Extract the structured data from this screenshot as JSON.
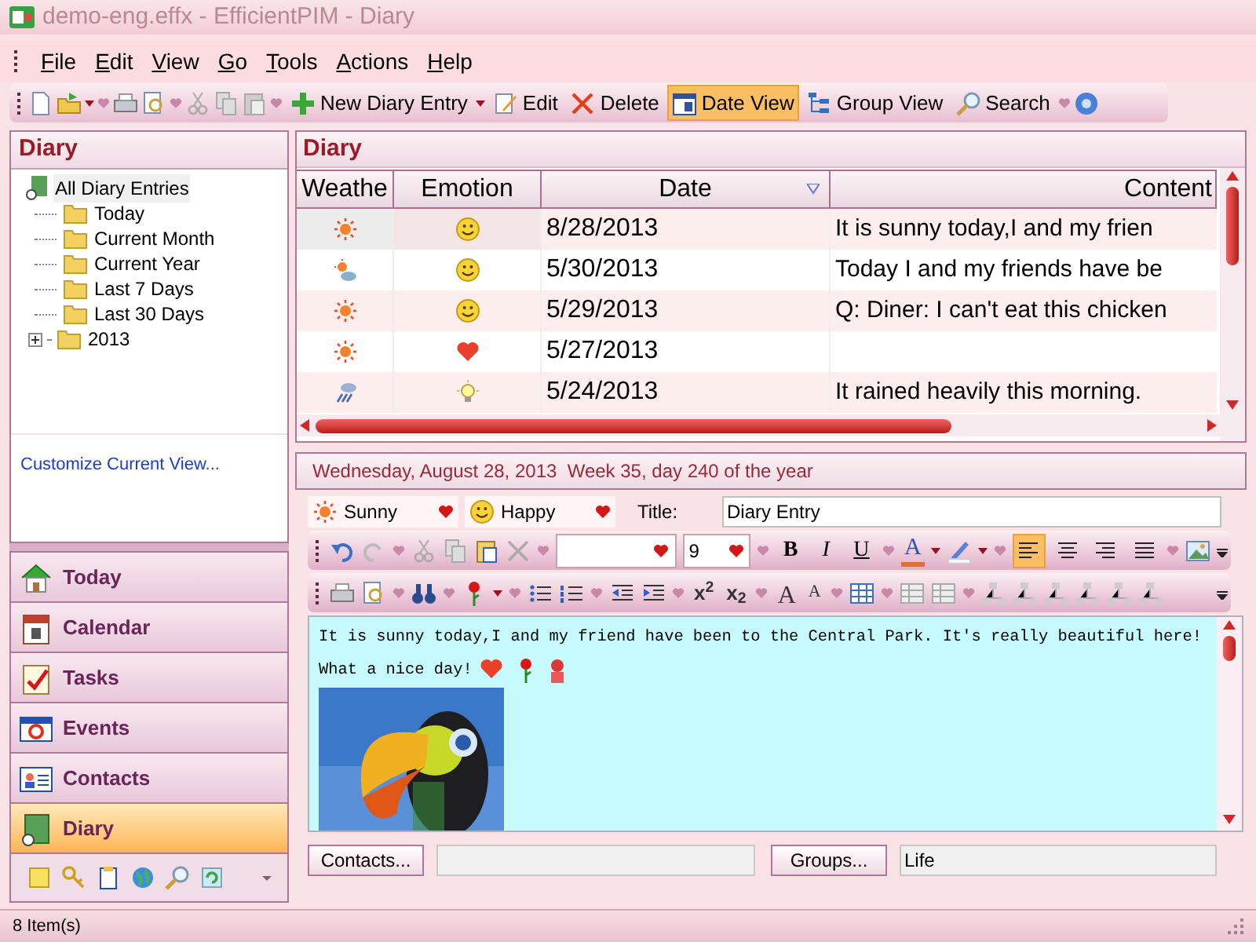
{
  "window": {
    "title": "demo-eng.effx - EfficientPIM - Diary"
  },
  "menu": [
    "File",
    "Edit",
    "View",
    "Go",
    "Tools",
    "Actions",
    "Help"
  ],
  "toolbar": [
    {
      "label": "New Diary Entry",
      "kind": "new",
      "selected": false
    },
    {
      "label": "Edit",
      "kind": "edit",
      "selected": false
    },
    {
      "label": "Delete",
      "kind": "delete",
      "selected": false
    },
    {
      "label": "Date View",
      "kind": "date",
      "selected": true
    },
    {
      "label": "Group View",
      "kind": "group",
      "selected": false
    },
    {
      "label": "Search",
      "kind": "search",
      "selected": false
    }
  ],
  "sidebar": {
    "title": "Diary",
    "tree": [
      {
        "label": "All Diary Entries",
        "children": [
          {
            "label": "Today"
          },
          {
            "label": "Current Month"
          },
          {
            "label": "Current Year"
          },
          {
            "label": "Last 7 Days"
          },
          {
            "label": "Last 30 Days"
          },
          {
            "label": "2013",
            "expanded": false
          }
        ]
      }
    ],
    "customize_link": "Customize Current View...",
    "nav": [
      {
        "label": "Today",
        "kind": "today",
        "selected": false
      },
      {
        "label": "Calendar",
        "kind": "calendar",
        "selected": false
      },
      {
        "label": "Tasks",
        "kind": "tasks",
        "selected": false
      },
      {
        "label": "Events",
        "kind": "events",
        "selected": false
      },
      {
        "label": "Contacts",
        "kind": "contacts",
        "selected": false
      },
      {
        "label": "Diary",
        "kind": "diary",
        "selected": true
      }
    ]
  },
  "diary": {
    "title": "Diary",
    "table": {
      "columns": [
        "Weathe",
        "Emotion",
        "Date",
        "Content"
      ],
      "rows": [
        {
          "weather": {
            "kind": "sunny"
          },
          "emotion": {
            "kind": "happy"
          },
          "date": "8/28/2013",
          "content": "It is sunny today,I and my frien",
          "selected": true
        },
        {
          "weather": {
            "kind": "partly_sunny"
          },
          "emotion": {
            "kind": "happy"
          },
          "date": "5/30/2013",
          "content": "Today I and my friends have be",
          "selected": false
        },
        {
          "weather": {
            "kind": "sunny"
          },
          "emotion": {
            "kind": "happy"
          },
          "date": "5/29/2013",
          "content": "Q: Diner: I can't eat this chicken",
          "selected": false
        },
        {
          "weather": {
            "kind": "sunny"
          },
          "emotion": {
            "kind": "love"
          },
          "date": "5/27/2013",
          "content": "",
          "selected": false
        },
        {
          "weather": {
            "kind": "rain"
          },
          "emotion": {
            "kind": "idea"
          },
          "date": "5/24/2013",
          "content": "It rained heavily this morning.",
          "selected": false
        }
      ]
    },
    "date_bar": "Wednesday, August 28, 2013  Week 35, day 240 of the year",
    "weather": {
      "value": "Sunny",
      "kind": "sunny"
    },
    "emotion": {
      "value": "Happy",
      "kind": "happy"
    },
    "title_label": "Title:",
    "title_value": "Diary Entry",
    "format_toolbar": {
      "font_size": "9",
      "bold": "B",
      "italic": "I",
      "underline": "U",
      "font_color": "A",
      "align": [
        {
          "selected": true
        },
        {
          "selected": false
        },
        {
          "selected": false
        },
        {
          "selected": false
        }
      ],
      "superscript": "x$^{2}$",
      "subscript": "x$_{2}$",
      "grow_font": "A",
      "shrink_font": "A"
    },
    "body": [
      "It is sunny today,I and my friend have been to the Central Park. It's really beautiful here!",
      "What a nice day!"
    ],
    "contacts_button": "Contacts...",
    "groups_button": "Groups...",
    "groups_value": "Life"
  },
  "status_bar": "8 Item(s)"
}
